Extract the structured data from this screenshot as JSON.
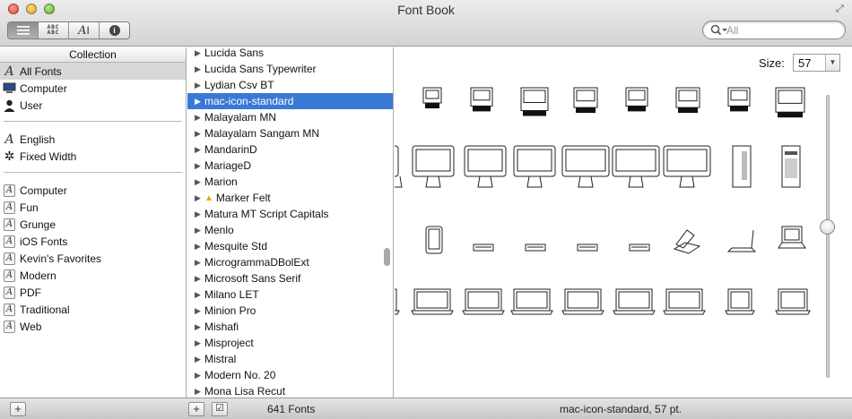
{
  "window": {
    "title": "Font Book"
  },
  "toolbar": {
    "view_buttons": [
      {
        "name": "list-view",
        "icon": "list-icon",
        "active": true
      },
      {
        "name": "sample-view",
        "icon": "abc-grid-icon",
        "text": "A B C\nA B C"
      },
      {
        "name": "custom-view",
        "icon": "custom-type-icon",
        "text": "AI"
      },
      {
        "name": "info-view",
        "icon": "info-icon",
        "text": "i"
      }
    ],
    "search": {
      "placeholder": "All"
    }
  },
  "collections": {
    "header": "Collection",
    "groups": [
      [
        {
          "label": "All Fonts",
          "icon": "font-a-icon",
          "selected": true
        },
        {
          "label": "Computer",
          "icon": "computer-icon"
        },
        {
          "label": "User",
          "icon": "user-icon"
        }
      ],
      [
        {
          "label": "English",
          "icon": "font-a-icon"
        },
        {
          "label": "Fixed Width",
          "icon": "gear-icon"
        }
      ],
      [
        {
          "label": "Computer",
          "icon": "collection-icon"
        },
        {
          "label": "Fun",
          "icon": "collection-icon"
        },
        {
          "label": "Grunge",
          "icon": "collection-icon"
        },
        {
          "label": "iOS Fonts",
          "icon": "collection-icon"
        },
        {
          "label": "Kevin's Favorites",
          "icon": "collection-icon"
        },
        {
          "label": "Modern",
          "icon": "collection-icon"
        },
        {
          "label": "PDF",
          "icon": "collection-icon"
        },
        {
          "label": "Traditional",
          "icon": "collection-icon"
        },
        {
          "label": "Web",
          "icon": "collection-icon"
        }
      ]
    ]
  },
  "fonts": {
    "items": [
      {
        "label": "Lucida Sans"
      },
      {
        "label": "Lucida Sans Typewriter"
      },
      {
        "label": "Lydian Csv BT"
      },
      {
        "label": "mac-icon-standard",
        "selected": true
      },
      {
        "label": "Malayalam MN"
      },
      {
        "label": "Malayalam Sangam MN"
      },
      {
        "label": "MandarinD"
      },
      {
        "label": "MariageD"
      },
      {
        "label": "Marion"
      },
      {
        "label": "Marker Felt",
        "warning": true
      },
      {
        "label": "Matura MT Script Capitals"
      },
      {
        "label": "Menlo"
      },
      {
        "label": "Mesquite Std"
      },
      {
        "label": "MicrogrammaDBolExt"
      },
      {
        "label": "Microsoft Sans Serif"
      },
      {
        "label": "Milano LET"
      },
      {
        "label": "Minion Pro"
      },
      {
        "label": "Mishafi"
      },
      {
        "label": "Misproject"
      },
      {
        "label": "Mistral"
      },
      {
        "label": "Modern No. 20"
      },
      {
        "label": "Mona Lisa Recut"
      }
    ]
  },
  "preview": {
    "size_label": "Size:",
    "size_value": "57",
    "rows": [
      {
        "kind": "classic-mac",
        "count": 9
      },
      {
        "kind": "imac",
        "count": 9
      },
      {
        "kind": "device",
        "count": 9
      },
      {
        "kind": "laptop",
        "count": 9
      }
    ]
  },
  "bottom": {
    "font_count": "641 Fonts",
    "status": "mac-icon-standard, 57 pt."
  },
  "colors": {
    "selection": "#3a78d6",
    "sidebar_selection": "#d7d7d7"
  }
}
